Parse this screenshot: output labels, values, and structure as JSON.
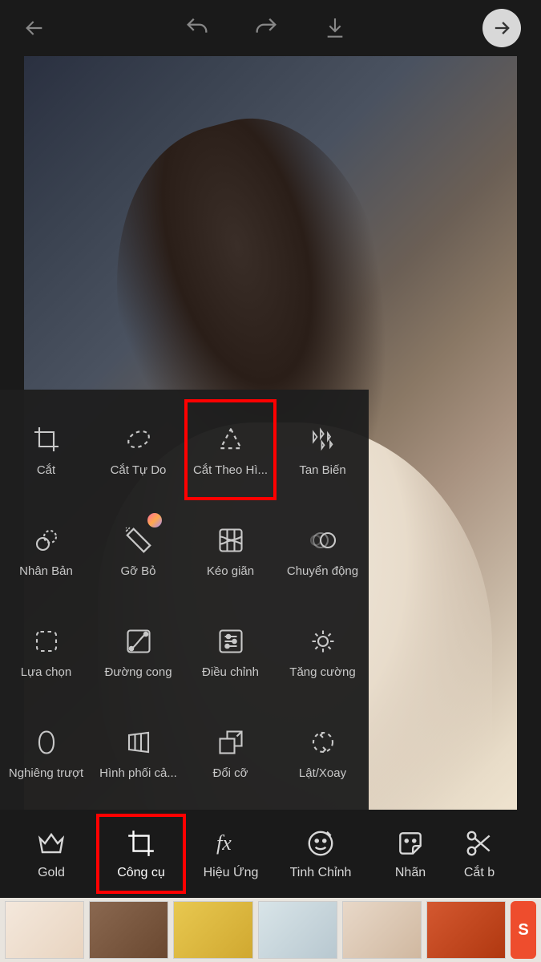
{
  "topbar": {
    "back": "back",
    "undo": "undo",
    "redo": "redo",
    "download": "download",
    "next": "next"
  },
  "tools": {
    "rows": [
      [
        {
          "icon": "crop-icon",
          "label": "Cắt"
        },
        {
          "icon": "freecrop-icon",
          "label": "Cắt Tự Do"
        },
        {
          "icon": "shapecrop-icon",
          "label": "Cắt Theo Hì...",
          "highlight": true
        },
        {
          "icon": "dispersion-icon",
          "label": "Tan Biến"
        }
      ],
      [
        {
          "icon": "clone-icon",
          "label": "Nhân Bản"
        },
        {
          "icon": "remove-icon",
          "label": "Gỡ Bỏ",
          "badge": true
        },
        {
          "icon": "stretch-icon",
          "label": "Kéo giãn"
        },
        {
          "icon": "motion-icon",
          "label": "Chuyển động"
        }
      ],
      [
        {
          "icon": "selection-icon",
          "label": "Lựa chọn"
        },
        {
          "icon": "curves-icon",
          "label": "Đường cong"
        },
        {
          "icon": "adjust-icon",
          "label": "Điều chỉnh"
        },
        {
          "icon": "enhance-icon",
          "label": "Tăng cường"
        }
      ],
      [
        {
          "icon": "tiltshift-icon",
          "label": "Nghiêng trượt"
        },
        {
          "icon": "perspective-icon",
          "label": "Hình phối cả..."
        },
        {
          "icon": "resize-icon",
          "label": "Đổi cỡ"
        },
        {
          "icon": "fliprotate-icon",
          "label": "Lật/Xoay"
        }
      ]
    ]
  },
  "bottomNav": {
    "items": [
      {
        "icon": "crown-icon",
        "label": "Gold"
      },
      {
        "icon": "crop-icon",
        "label": "Công cụ",
        "highlight": true
      },
      {
        "icon": "fx-icon",
        "label": "Hiệu Ứng"
      },
      {
        "icon": "retouch-icon",
        "label": "Tinh Chỉnh"
      },
      {
        "icon": "sticker-icon",
        "label": "Nhãn"
      },
      {
        "icon": "cutout-icon",
        "label": "Cắt b"
      }
    ]
  },
  "ad": {
    "brand": "S"
  }
}
